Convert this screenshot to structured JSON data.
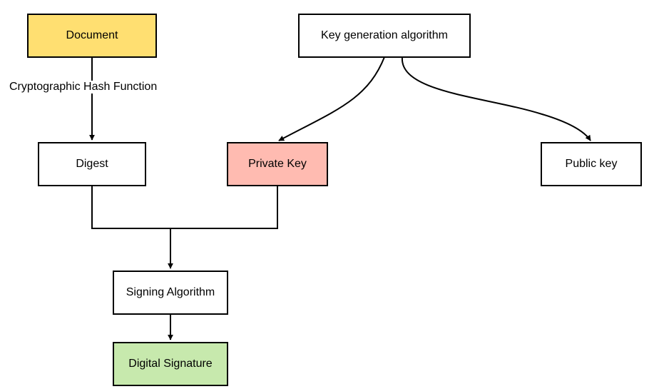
{
  "nodes": {
    "document": {
      "label": "Document",
      "fill": "#FFDF71"
    },
    "keygen": {
      "label": "Key generation algorithm",
      "fill": "#FFFFFF"
    },
    "digest": {
      "label": "Digest",
      "fill": "#FFFFFF"
    },
    "private_key": {
      "label": "Private Key",
      "fill": "#FFBBB1"
    },
    "public_key": {
      "label": "Public key",
      "fill": "#FFFFFF"
    },
    "signing": {
      "label": "Signing Algorithm",
      "fill": "#FFFFFF"
    },
    "signature": {
      "label": "Digital Signature",
      "fill": "#C7E9AD"
    }
  },
  "edges": [
    {
      "from": "Document",
      "to": "Digest",
      "label": "Cryptographic Hash Function"
    },
    {
      "from": "Key generation algorithm",
      "to": "Private Key"
    },
    {
      "from": "Key generation algorithm",
      "to": "Public key"
    },
    {
      "from": "Digest",
      "to": "Signing Algorithm"
    },
    {
      "from": "Private Key",
      "to": "Signing Algorithm"
    },
    {
      "from": "Signing Algorithm",
      "to": "Digital Signature"
    }
  ]
}
